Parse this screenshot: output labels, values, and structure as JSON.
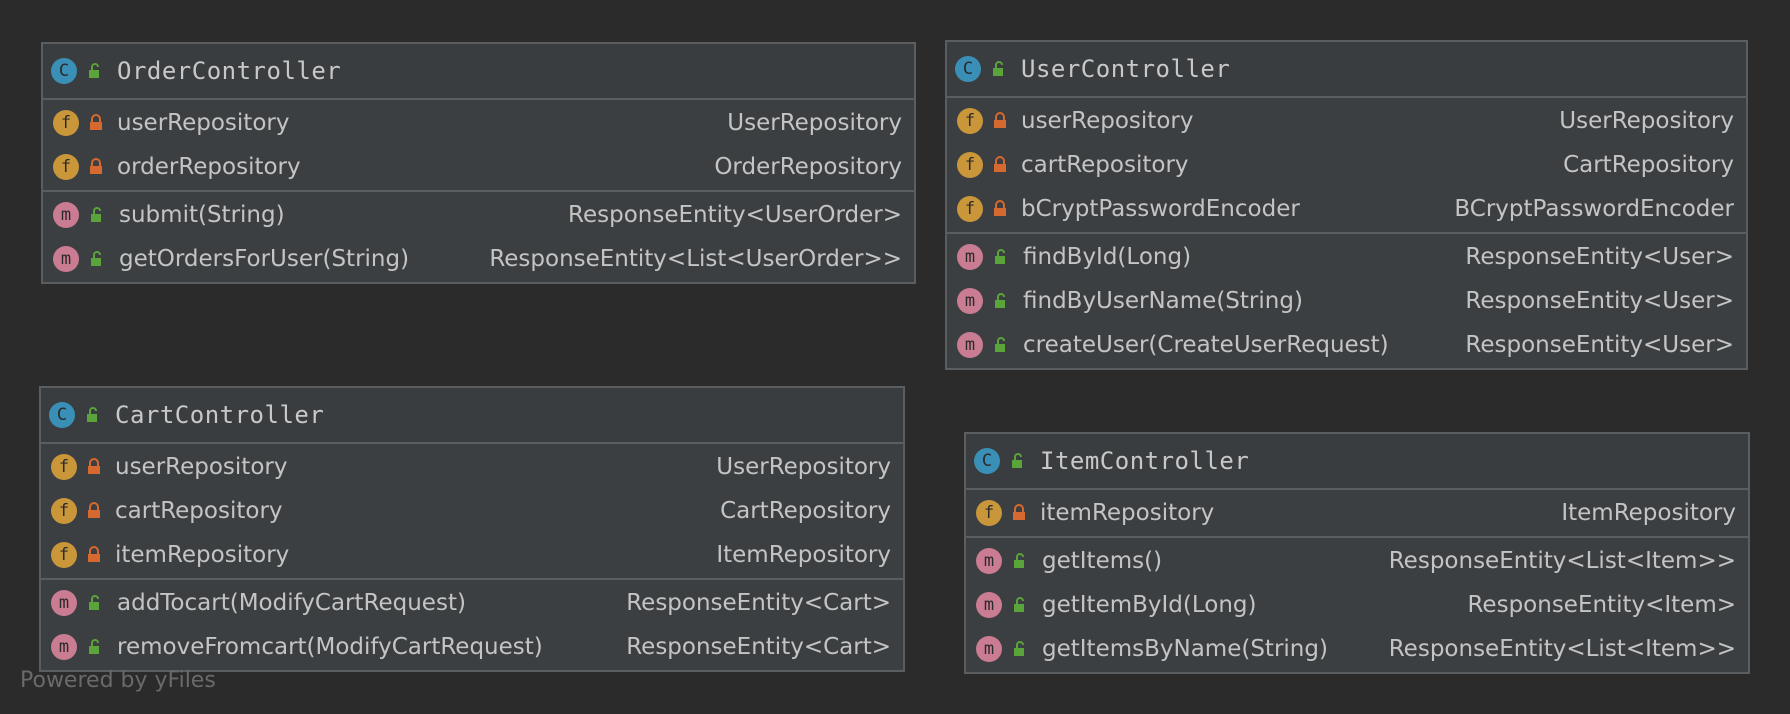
{
  "colors": {
    "background": "#2b2b2b",
    "box": "#3c3f41",
    "class_icon": "#3a8fb7",
    "field_icon": "#c9973a",
    "method_icon": "#c97c92",
    "private_lock": "#d5692f",
    "public_lock": "#5ba33b"
  },
  "icons": {
    "class": "C",
    "field": "f",
    "method": "m"
  },
  "boxes": {
    "order": {
      "title": "OrderController",
      "fields": [
        {
          "name": "userRepository",
          "type": "UserRepository"
        },
        {
          "name": "orderRepository",
          "type": "OrderRepository"
        }
      ],
      "methods": [
        {
          "name": "submit(String)",
          "type": "ResponseEntity<UserOrder>"
        },
        {
          "name": "getOrdersForUser(String)",
          "type": "ResponseEntity<List<UserOrder>>"
        }
      ]
    },
    "user": {
      "title": "UserController",
      "fields": [
        {
          "name": "userRepository",
          "type": "UserRepository"
        },
        {
          "name": "cartRepository",
          "type": "CartRepository"
        },
        {
          "name": "bCryptPasswordEncoder",
          "type": "BCryptPasswordEncoder"
        }
      ],
      "methods": [
        {
          "name": "findById(Long)",
          "type": "ResponseEntity<User>"
        },
        {
          "name": "findByUserName(String)",
          "type": "ResponseEntity<User>"
        },
        {
          "name": "createUser(CreateUserRequest)",
          "type": "ResponseEntity<User>"
        }
      ]
    },
    "cart": {
      "title": "CartController",
      "fields": [
        {
          "name": "userRepository",
          "type": "UserRepository"
        },
        {
          "name": "cartRepository",
          "type": "CartRepository"
        },
        {
          "name": "itemRepository",
          "type": "ItemRepository"
        }
      ],
      "methods": [
        {
          "name": "addTocart(ModifyCartRequest)",
          "type": "ResponseEntity<Cart>"
        },
        {
          "name": "removeFromcart(ModifyCartRequest)",
          "type": "ResponseEntity<Cart>"
        }
      ]
    },
    "item": {
      "title": "ItemController",
      "fields": [
        {
          "name": "itemRepository",
          "type": "ItemRepository"
        }
      ],
      "methods": [
        {
          "name": "getItems()",
          "type": "ResponseEntity<List<Item>>"
        },
        {
          "name": "getItemById(Long)",
          "type": "ResponseEntity<Item>"
        },
        {
          "name": "getItemsByName(String)",
          "type": "ResponseEntity<List<Item>>"
        }
      ]
    }
  },
  "footer": {
    "text": "Powered by yFiles"
  }
}
